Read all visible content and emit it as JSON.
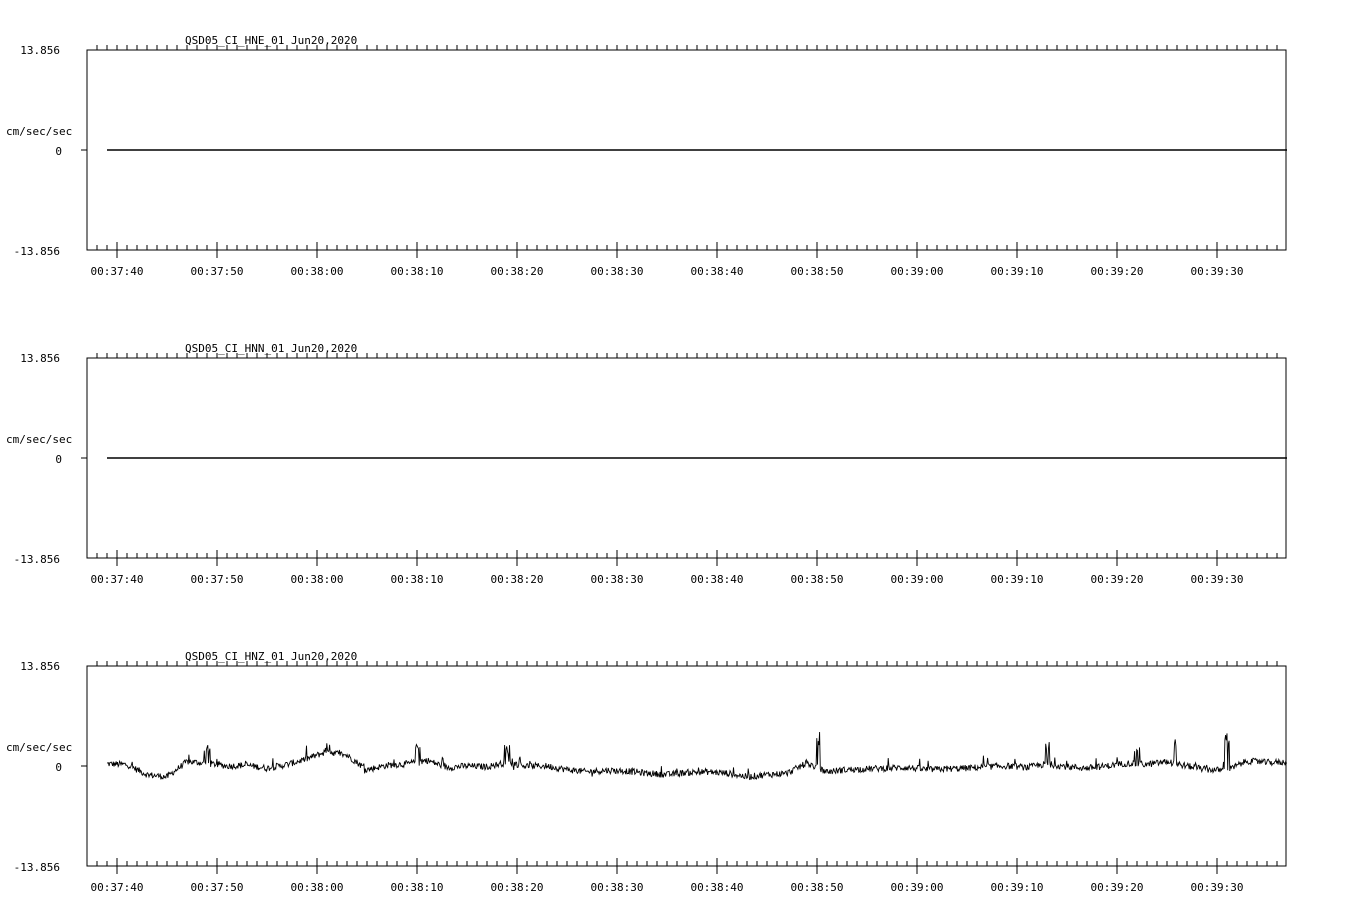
{
  "chart_data": [
    {
      "type": "line",
      "title": "QSD05_CI_HNE_01  Jun20,2020",
      "ylabel": "cm/sec/sec",
      "y_tick_labels": [
        "13.856",
        "0",
        "-13.856"
      ],
      "ylim": [
        -13.856,
        13.856
      ],
      "x_tick_labels": [
        "00:37:40",
        "00:37:50",
        "00:38:00",
        "00:38:10",
        "00:38:20",
        "00:38:30",
        "00:38:40",
        "00:38:50",
        "00:39:00",
        "00:39:10",
        "00:39:20",
        "00:39:30"
      ],
      "trace": "flat",
      "series": [
        {
          "x": [
            "00:37:39",
            "00:39:37"
          ],
          "values": [
            0,
            0
          ]
        }
      ],
      "grid": false
    },
    {
      "type": "line",
      "title": "QSD05_CI_HNN_01  Jun20,2020",
      "ylabel": "cm/sec/sec",
      "y_tick_labels": [
        "13.856",
        "0",
        "-13.856"
      ],
      "ylim": [
        -13.856,
        13.856
      ],
      "x_tick_labels": [
        "00:37:40",
        "00:37:50",
        "00:38:00",
        "00:38:10",
        "00:38:20",
        "00:38:30",
        "00:38:40",
        "00:38:50",
        "00:39:00",
        "00:39:10",
        "00:39:20",
        "00:39:30"
      ],
      "trace": "flat",
      "series": [
        {
          "x": [
            "00:37:39",
            "00:39:37"
          ],
          "values": [
            0,
            0
          ]
        }
      ],
      "grid": false
    },
    {
      "type": "line",
      "title": "QSD05_CI_HNZ_01  Jun20,2020",
      "ylabel": "cm/sec/sec",
      "y_tick_labels": [
        "13.856",
        "0",
        "-13.856"
      ],
      "ylim": [
        -13.856,
        13.856
      ],
      "x_tick_labels": [
        "00:37:40",
        "00:37:50",
        "00:38:00",
        "00:38:10",
        "00:38:20",
        "00:38:30",
        "00:38:40",
        "00:38:50",
        "00:39:00",
        "00:39:10",
        "00:39:20",
        "00:39:30"
      ],
      "trace": "noisy",
      "series": [
        {
          "x": [
            "00:37:39",
            "00:37:41",
            "00:37:43",
            "00:37:45",
            "00:37:47",
            "00:37:49",
            "00:37:51",
            "00:37:53",
            "00:37:55",
            "00:37:57",
            "00:37:59",
            "00:38:01",
            "00:38:03",
            "00:38:05",
            "00:38:07",
            "00:38:09",
            "00:38:11",
            "00:38:13",
            "00:38:15",
            "00:38:17",
            "00:38:19",
            "00:38:21",
            "00:38:23",
            "00:38:25",
            "00:38:27",
            "00:38:29",
            "00:38:31",
            "00:38:33",
            "00:38:35",
            "00:38:37",
            "00:38:39",
            "00:38:41",
            "00:38:43",
            "00:38:45",
            "00:38:47",
            "00:38:49",
            "00:38:51",
            "00:38:53",
            "00:38:55",
            "00:38:57",
            "00:38:59",
            "00:39:01",
            "00:39:03",
            "00:39:05",
            "00:39:07",
            "00:39:09",
            "00:39:11",
            "00:39:13",
            "00:39:15",
            "00:39:17",
            "00:39:19",
            "00:39:21",
            "00:39:23",
            "00:39:25",
            "00:39:27",
            "00:39:29",
            "00:39:31",
            "00:39:33",
            "00:39:35",
            "00:39:37"
          ],
          "values": [
            0.3,
            0.2,
            -1.2,
            -1.5,
            0.6,
            0.4,
            0.0,
            0.1,
            -0.3,
            0.2,
            1.0,
            2.0,
            1.5,
            -0.5,
            0.1,
            0.3,
            0.8,
            -0.2,
            0.0,
            -0.1,
            0.5,
            0.0,
            0.0,
            -0.5,
            -0.8,
            -0.6,
            -0.7,
            -1.0,
            -1.2,
            -0.9,
            -0.8,
            -1.0,
            -1.5,
            -1.2,
            -1.0,
            0.4,
            -0.8,
            -0.5,
            -0.4,
            -0.3,
            -0.2,
            -0.5,
            -0.4,
            -0.3,
            -0.1,
            0.0,
            -0.2,
            0.3,
            -0.1,
            -0.3,
            0.0,
            0.4,
            0.2,
            0.6,
            0.0,
            -0.5,
            -0.6,
            0.7,
            0.5,
            0.5
          ],
          "peaks": [
            {
              "x": "00:37:49",
              "value": 3.3
            },
            {
              "x": "00:38:01",
              "value": 3.3
            },
            {
              "x": "00:38:10",
              "value": 3.0
            },
            {
              "x": "00:38:19",
              "value": 3.0
            },
            {
              "x": "00:38:50",
              "value": 4.8
            },
            {
              "x": "00:39:13",
              "value": 3.6
            },
            {
              "x": "00:39:22",
              "value": 3.2
            },
            {
              "x": "00:39:26",
              "value": 4.2
            },
            {
              "x": "00:39:31",
              "value": 4.6
            }
          ]
        }
      ],
      "grid": false
    }
  ]
}
